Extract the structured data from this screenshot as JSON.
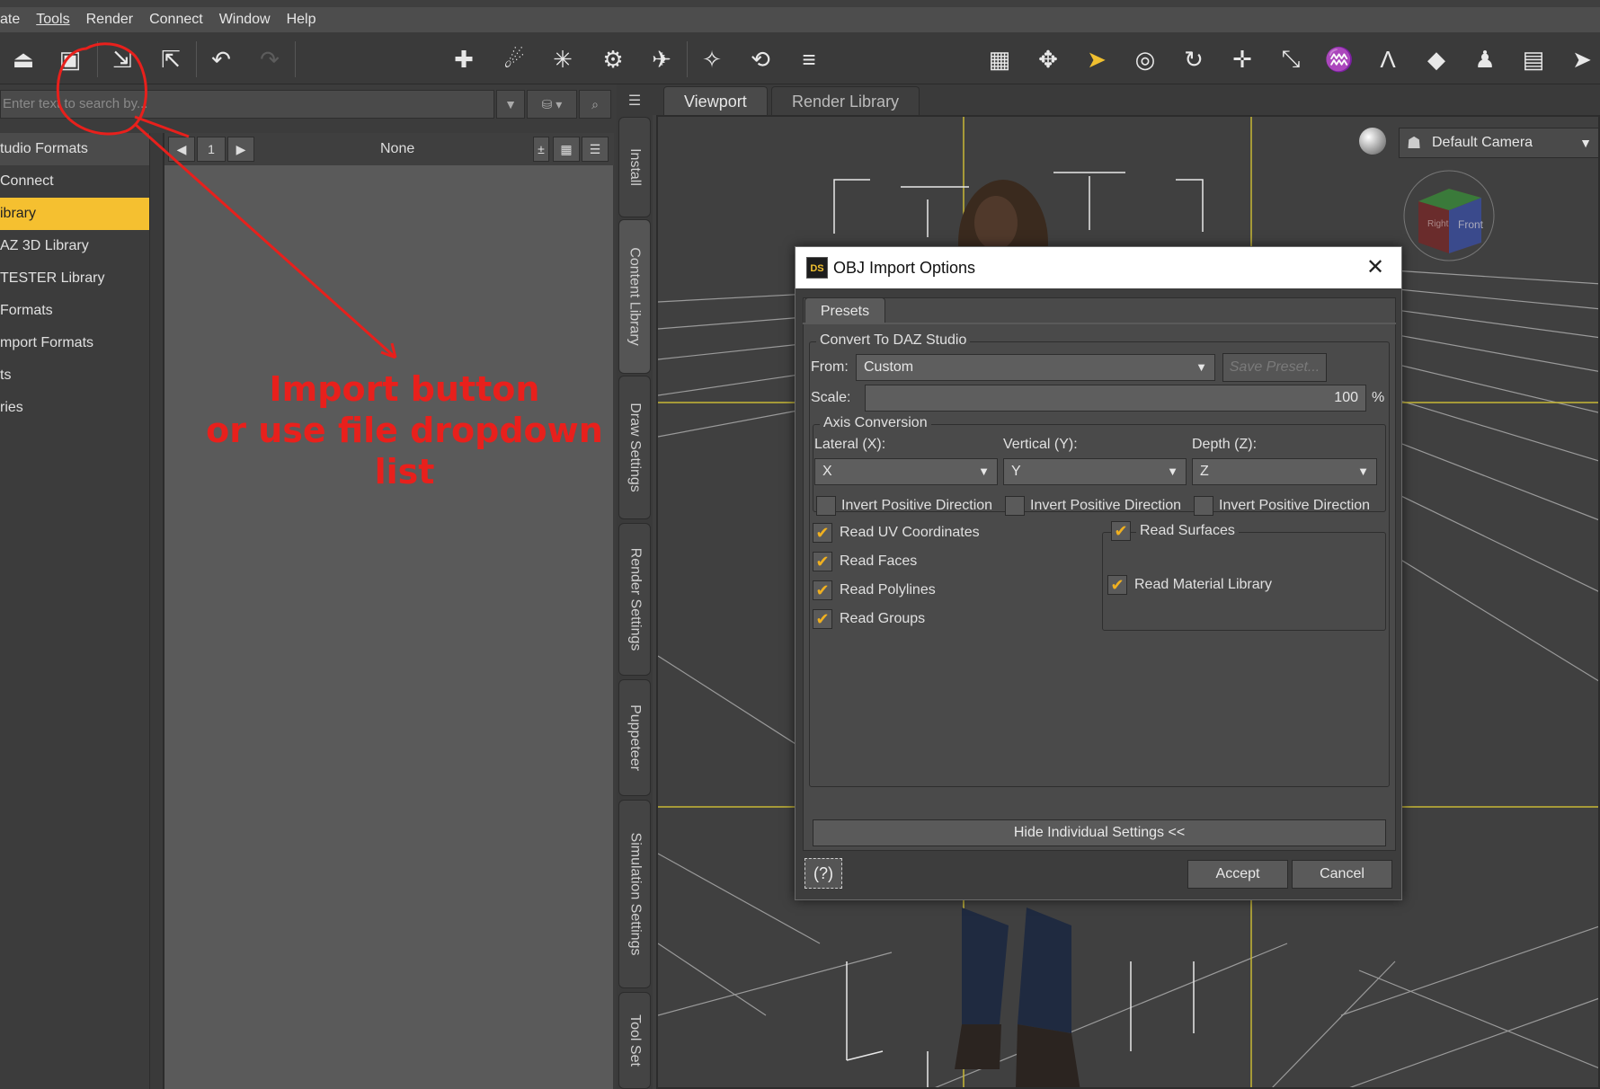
{
  "menubar": {
    "items": [
      "ate",
      "Tools",
      "Render",
      "Connect",
      "Window",
      "Help"
    ]
  },
  "search": {
    "placeholder": "Enter text to search by..."
  },
  "left_tree": {
    "items": [
      {
        "label": "tudio Formats",
        "state": "header"
      },
      {
        "label": "Connect",
        "state": "normal"
      },
      {
        "label": "ibrary",
        "state": "selected"
      },
      {
        "label": "AZ 3D Library",
        "state": "normal"
      },
      {
        "label": "TESTER Library",
        "state": "normal"
      },
      {
        "label": "Formats",
        "state": "normal"
      },
      {
        "label": "mport Formats",
        "state": "normal"
      },
      {
        "label": "ts",
        "state": "normal"
      },
      {
        "label": "ries",
        "state": "normal"
      }
    ]
  },
  "pager": {
    "page": "1",
    "filter": "None"
  },
  "vertical_tabs": [
    "Install",
    "Content Library",
    "Draw Settings",
    "Render Settings",
    "Puppeteer",
    "Simulation Settings",
    "Tool Set"
  ],
  "view_tabs": {
    "viewport": "Viewport",
    "render_library": "Render Library"
  },
  "camera": {
    "selected": "Default Camera"
  },
  "annotation": {
    "line1": "Import button",
    "line2": "or use file dropdown list",
    "color": "#e8201c"
  },
  "dialog": {
    "title": "OBJ Import Options",
    "icon_text": "DS",
    "tab": "Presets",
    "convert_group": "Convert To DAZ Studio",
    "from_label": "From:",
    "from_value": "Custom",
    "save_preset": "Save Preset...",
    "scale_label": "Scale:",
    "scale_value": "100",
    "scale_unit": "%",
    "axis_group": "Axis Conversion",
    "lateral_label": "Lateral (X):",
    "vertical_label": "Vertical (Y):",
    "depth_label": "Depth (Z):",
    "lateral_value": "X",
    "vertical_value": "Y",
    "depth_value": "Z",
    "invert_label": "Invert Positive Direction",
    "checks_left": [
      "Read UV Coordinates",
      "Read Faces",
      "Read Polylines",
      "Read Groups"
    ],
    "read_surfaces": "Read Surfaces",
    "read_material": "Read Material Library",
    "hide_settings": "Hide Individual Settings <<",
    "help": "(?)",
    "accept": "Accept",
    "cancel": "Cancel"
  }
}
